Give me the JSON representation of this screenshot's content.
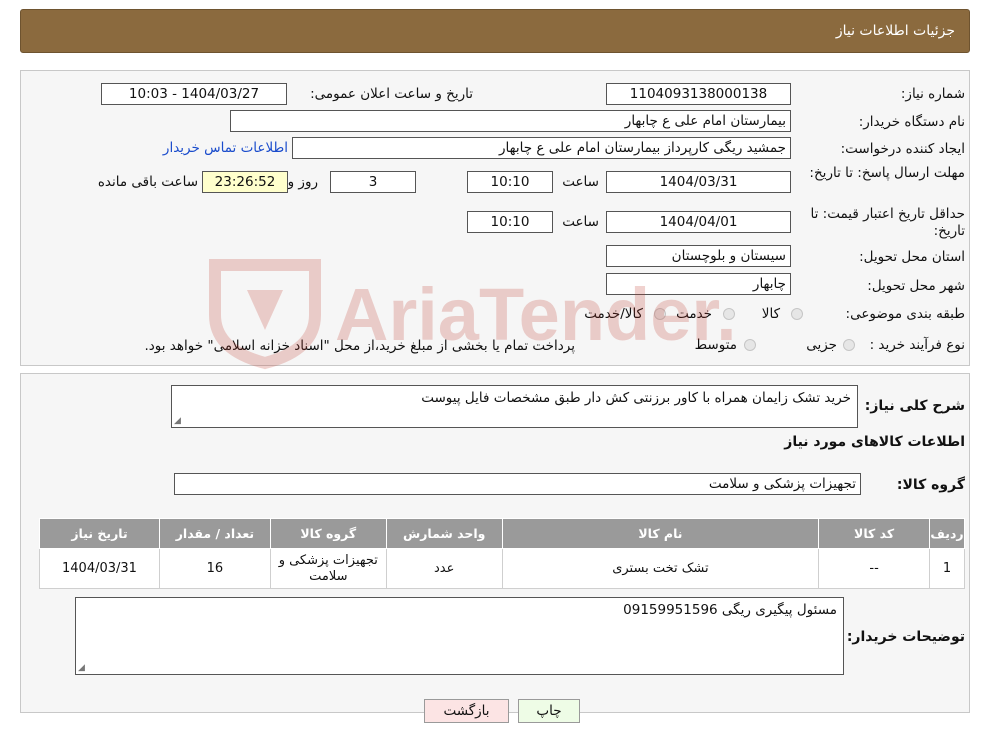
{
  "header": {
    "title": "جزئیات اطلاعات نیاز"
  },
  "form": {
    "need_number_label": "شماره نیاز:",
    "need_number": "1104093138000138",
    "announce_label": "تاریخ و ساعت اعلان عمومی:",
    "announce_value": "1404/03/27 - 10:03",
    "buyer_org_label": "نام دستگاه خریدار:",
    "buyer_org": "بیمارستان امام علی  ع  چابهار",
    "requester_label": "ایجاد کننده درخواست:",
    "requester": "جمشید ریگی کارپرداز بیمارستان امام علی  ع  چابهار",
    "contact_link": "اطلاعات تماس خریدار",
    "deadline_label": "مهلت ارسال پاسخ: تا تاریخ:",
    "deadline_date": "1404/03/31",
    "time_label": "ساعت",
    "deadline_time": "10:10",
    "days_value": "3",
    "days_label": "روز و",
    "remaining_time": "23:26:52",
    "remaining_label": "ساعت باقی مانده",
    "validity_label": "حداقل تاریخ اعتبار قیمت: تا تاریخ:",
    "validity_date": "1404/04/01",
    "validity_time": "10:10",
    "province_label": "استان محل تحویل:",
    "province": "سیستان و بلوچستان",
    "city_label": "شهر محل تحویل:",
    "city": "چابهار",
    "category_label": "طبقه بندی موضوعی:",
    "category_options": [
      "کالا",
      "خدمت",
      "کالا/خدمت"
    ],
    "process_label": "نوع فرآیند خرید :",
    "process_options": [
      "جزیی",
      "متوسط"
    ],
    "process_note": "پرداخت تمام یا بخشی از مبلغ خرید،از محل \"اسناد خزانه اسلامی\" خواهد بود."
  },
  "details": {
    "description_label": "شرح کلی نیاز:",
    "description": "خرید تشک زایمان همراه با کاور برزنتی کش دار طبق مشخصات فایل پیوست",
    "goods_info_title": "اطلاعات کالاهای مورد نیاز",
    "goods_group_label": "گروه کالا:",
    "goods_group": "تجهیزات پزشکی و سلامت"
  },
  "table": {
    "headers": [
      "ردیف",
      "کد کالا",
      "نام کالا",
      "واحد شمارش",
      "گروه کالا",
      "تعداد / مقدار",
      "تاریخ نیاز"
    ],
    "rows": [
      [
        "1",
        "--",
        "تشک تخت بستری",
        "عدد",
        "تجهیزات پزشکی و سلامت",
        "16",
        "1404/03/31"
      ]
    ]
  },
  "buyer_notes": {
    "label": "توضیحات خریدار:",
    "text": "مسئول پیگیری ریگی 09159951596"
  },
  "buttons": {
    "print": "چاپ",
    "back": "بازگشت"
  },
  "watermark": {
    "text": "AriaTender.neT"
  },
  "colors": {
    "header_bg": "#8b6a3e",
    "link": "#1a4ccc",
    "yellow_box": "#ffffcc",
    "table_header": "#9a9a9a",
    "watermark": "#c0392b"
  }
}
